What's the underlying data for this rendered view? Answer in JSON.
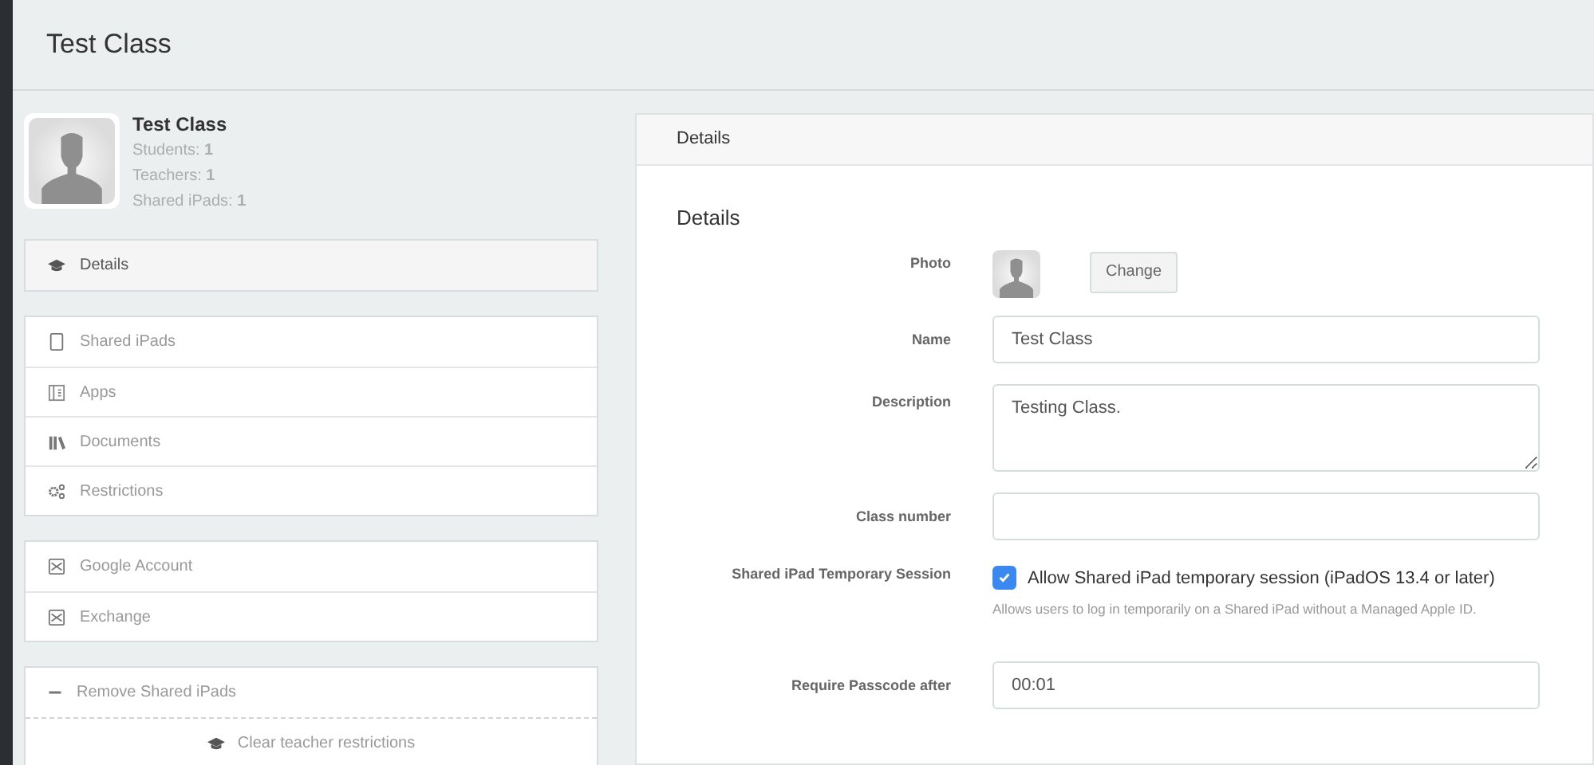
{
  "page_title": "Test Class",
  "class_card": {
    "name": "Test Class",
    "stats": [
      "Students: **1**",
      "Teachers: **1**",
      "Shared iPads: **1**"
    ]
  },
  "nav_groups": [
    {
      "items": [
        {
          "label": "Details",
          "selected": true
        }
      ]
    },
    {
      "items": [
        {
          "label": "Shared iPads",
          "selected": false
        },
        {
          "label": "Apps",
          "selected": false
        },
        {
          "label": "Documents",
          "selected": false
        },
        {
          "label": "Restrictions",
          "selected": false
        }
      ]
    },
    {
      "items": [
        {
          "label": "Google Account",
          "selected": false
        },
        {
          "label": "Exchange",
          "selected": false
        }
      ]
    }
  ],
  "actions": {
    "remove": "Remove Shared iPads",
    "clear": "Clear teacher restrictions"
  },
  "panel": {
    "header": "Details",
    "section_title": "Details",
    "fields": [
      {
        "kind": "photo",
        "label": "Photo",
        "button": "Change"
      },
      {
        "kind": "text",
        "label": "Name",
        "value": "Test Class"
      },
      {
        "kind": "textarea",
        "label": "Description",
        "value": "Testing Class."
      },
      {
        "kind": "text",
        "label": "Class number"
      },
      {
        "kind": "checkbox",
        "label": "Shared iPad Temporary Session",
        "checked": true,
        "option": "Allow Shared iPad temporary session (iPadOS 13.4 or later)",
        "help": "Allows users to log in temporarily on a Shared iPad without a Managed Apple ID."
      },
      {
        "kind": "text",
        "label": "Require Passcode after",
        "value": "00:01"
      }
    ]
  }
}
